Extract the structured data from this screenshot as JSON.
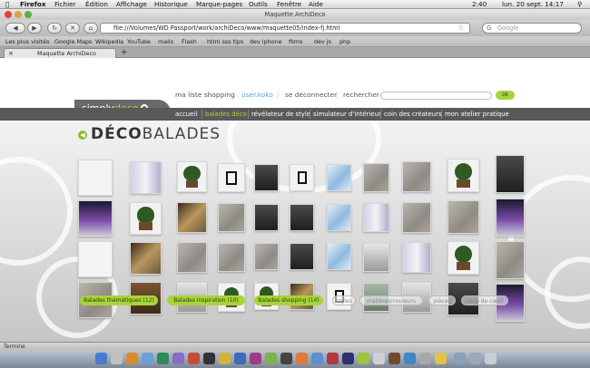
{
  "menubar": {
    "items": [
      "Firefox",
      "Fichier",
      "Édition",
      "Affichage",
      "Historique",
      "Marque-pages",
      "Outils",
      "Fenêtre",
      "Aide"
    ],
    "clock": "lun. 20 sept.  14:17",
    "battery": "2:40"
  },
  "window": {
    "title": "Maquette ArchiDeco"
  },
  "toolbar": {
    "url": "file:///Volumes/WD Passport/work/archiDeco/www/maquette05/index-fj.html",
    "search_placeholder": "Google"
  },
  "bookmarks": [
    "Les plus visités",
    "Google Maps",
    "Wikipedia",
    "YouTube",
    "mails",
    "Flash",
    "html sss tips",
    "dev iphone",
    "films",
    "dev js",
    "php"
  ],
  "tabs": [
    {
      "label": "Maquette ArchiDeco"
    }
  ],
  "site": {
    "logo": {
      "part1": "simply",
      "part2": "deco"
    },
    "topnav": {
      "shopping_list": "ma liste shopping",
      "user": "user.koko",
      "logout": "se déconnecter",
      "search_label": "rechercher :",
      "search_button": "ok"
    },
    "mainnav": [
      "accueil",
      "balades déco",
      "révélateur de style",
      "simulateur d'intérieur",
      "coin des créateurs",
      "mon atelier pratique"
    ],
    "title": {
      "bold": "DÉCO",
      "light": "BALADES"
    },
    "pills": [
      "Balades thématiques (12)",
      "Balades inspiration (10)",
      "Balades shopping (14)",
      "styles",
      "matières/couleurs",
      "pièces",
      "coup de cœur"
    ]
  },
  "statusbar": {
    "text": "Terminé"
  }
}
